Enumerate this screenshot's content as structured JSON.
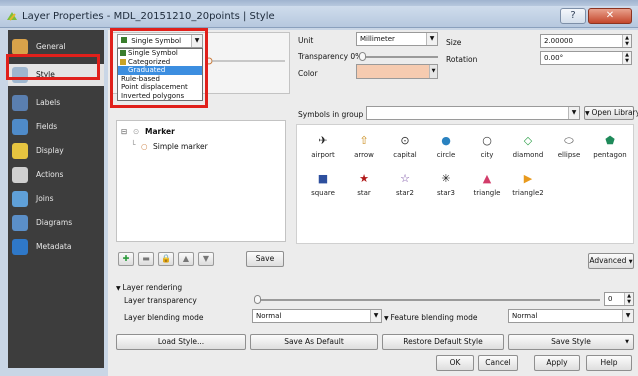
{
  "window": {
    "title": "Layer Properties - MDL_20151210_20points | Style",
    "help_glyph": "?",
    "close_glyph": "✕"
  },
  "sidebar": {
    "items": [
      {
        "label": "General",
        "icon": "wrench-icon",
        "color": "#d8a24a"
      },
      {
        "label": "Style",
        "icon": "brush-icon",
        "color": "#9fb7cf",
        "active": true
      },
      {
        "label": "Labels",
        "icon": "abc-icon",
        "color": "#5a7fb0"
      },
      {
        "label": "Fields",
        "icon": "table-icon",
        "color": "#4f8bc9"
      },
      {
        "label": "Display",
        "icon": "speech-bubble-icon",
        "color": "#e6c440"
      },
      {
        "label": "Actions",
        "icon": "gear-icon",
        "color": "#cfcfcf"
      },
      {
        "label": "Joins",
        "icon": "join-arrow-icon",
        "color": "#5fa0d8"
      },
      {
        "label": "Diagrams",
        "icon": "diagram-icon",
        "color": "#5b8fc8"
      },
      {
        "label": "Metadata",
        "icon": "info-icon",
        "color": "#2f78c8"
      }
    ]
  },
  "renderer": {
    "selected": "Single Symbol",
    "options": [
      {
        "label": "Single Symbol",
        "swatch": "#3a7d2d"
      },
      {
        "label": "Categorized",
        "swatch": "#c9a227"
      },
      {
        "label": "Graduated",
        "swatch": "#3c8ee0",
        "highlighted": true
      },
      {
        "label": "Rule-based"
      },
      {
        "label": "Point displacement"
      },
      {
        "label": "Inverted polygons"
      }
    ]
  },
  "properties": {
    "unit_label": "Unit",
    "unit_value": "Millimeter",
    "transparency_label": "Transparency 0%",
    "color_label": "Color",
    "color_value": "#f6cbb0",
    "size_label": "Size",
    "size_value": "2.00000",
    "rotation_label": "Rotation",
    "rotation_value": "0.00°"
  },
  "symbols": {
    "group_label": "Symbols in group",
    "open_library": "Open Library",
    "items": [
      {
        "name": "airport",
        "glyph": "✈",
        "color": "#222222"
      },
      {
        "name": "arrow",
        "glyph": "⇧",
        "color": "#c98a18"
      },
      {
        "name": "capital",
        "glyph": "⊙",
        "color": "#333333"
      },
      {
        "name": "circle",
        "glyph": "●",
        "color": "#2a82c0"
      },
      {
        "name": "city",
        "glyph": "○",
        "color": "#333333"
      },
      {
        "name": "diamond",
        "glyph": "◇",
        "color": "#2fa04a"
      },
      {
        "name": "ellipse",
        "glyph": "⬭",
        "color": "#444444"
      },
      {
        "name": "pentagon",
        "glyph": "⬟",
        "color": "#1f8a5a"
      },
      {
        "name": "square",
        "glyph": "■",
        "color": "#2d4f9e"
      },
      {
        "name": "star",
        "glyph": "★",
        "color": "#b01818"
      },
      {
        "name": "star2",
        "glyph": "☆",
        "color": "#6b3e9a"
      },
      {
        "name": "star3",
        "glyph": "✳",
        "color": "#222222"
      },
      {
        "name": "triangle",
        "glyph": "▲",
        "color": "#d23c6a"
      },
      {
        "name": "triangle2",
        "glyph": "▶",
        "color": "#e89a1e"
      }
    ]
  },
  "tree": {
    "root": "Marker",
    "child": "Simple marker"
  },
  "toolbar": {
    "save_label": "Save",
    "advanced_label": "Advanced"
  },
  "layer_rendering": {
    "header": "Layer rendering",
    "transparency_label": "Layer transparency",
    "transparency_value": "0",
    "blending_label": "Layer blending mode",
    "blending_value": "Normal",
    "feature_blending_label": "Feature blending mode",
    "feature_blending_value": "Normal"
  },
  "style_buttons": {
    "load": "Load Style...",
    "save_default": "Save As Default",
    "restore_default": "Restore Default Style",
    "save_style": "Save Style"
  },
  "dialog_buttons": {
    "ok": "OK",
    "cancel": "Cancel",
    "apply": "Apply",
    "help": "Help"
  }
}
